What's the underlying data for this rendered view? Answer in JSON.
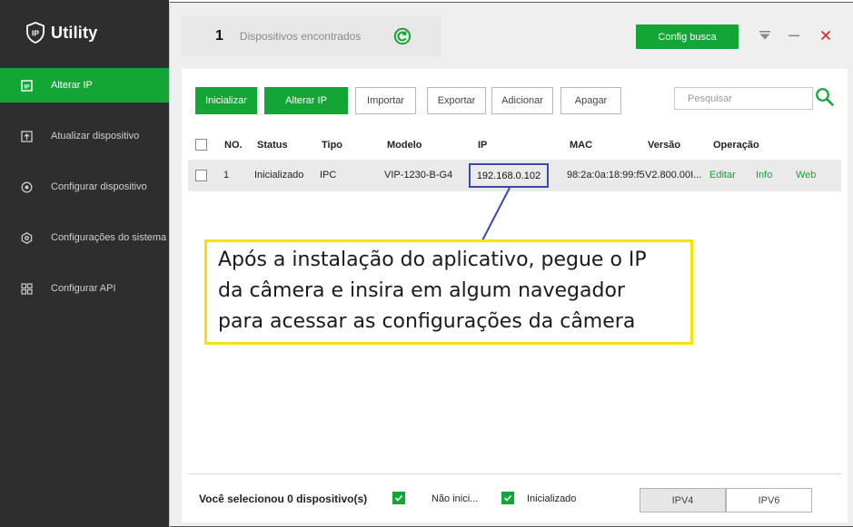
{
  "app": {
    "name": "Utility"
  },
  "sidebar": {
    "items": [
      {
        "label": "Alterar IP",
        "icon": "ip-icon",
        "active": true
      },
      {
        "label": "Atualizar dispositivo",
        "icon": "upload-icon",
        "active": false
      },
      {
        "label": "Configurar dispositivo",
        "icon": "target-icon",
        "active": false
      },
      {
        "label": "Configurações do sistema",
        "icon": "settings-hex-icon",
        "active": false
      },
      {
        "label": "Configurar API",
        "icon": "grid-icon",
        "active": false
      }
    ]
  },
  "header": {
    "found_count": "1",
    "found_label": "Dispositivos encontrados",
    "config_button": "Config busca"
  },
  "toolbar": {
    "buttons": [
      "Inicializar",
      "Alterar IP",
      "Importar",
      "Exportar",
      "Adicionar",
      "Apagar"
    ],
    "search_placeholder": "Pesquisar"
  },
  "table": {
    "headers": [
      "NO.",
      "Status",
      "Tipo",
      "Modelo",
      "IP",
      "MAC",
      "Versão",
      "Operação"
    ],
    "rows": [
      {
        "no": "1",
        "status": "Inicializado",
        "tipo": "IPC",
        "modelo": "VIP-1230-B-G4",
        "ip": "192.168.0.102",
        "mac": "98:2a:0a:18:99:f5",
        "versao": "V2.800.00I...",
        "ops": [
          "Editar",
          "Info",
          "Web"
        ]
      }
    ]
  },
  "footer": {
    "selected_text": "Você selecionou 0 dispositivo(s)",
    "filter_uninit": "Não inici...",
    "filter_init": "Inicializado",
    "ipv4": "IPV4",
    "ipv6": "IPV6"
  },
  "callout": {
    "lines": [
      "Após a instalação do aplicativo, pegue o IP",
      "da câmera e insira em algum navegador",
      "para acessar as configurações da câmera"
    ]
  },
  "colors": {
    "accent": "#14a537",
    "sidebar": "#2e2e2e",
    "highlight": "#3b49a6",
    "callout_border": "#f2e400"
  }
}
